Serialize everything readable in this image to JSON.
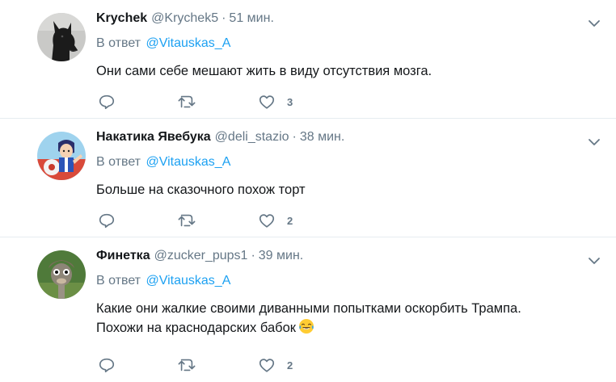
{
  "tweets": [
    {
      "fullname": "Krychek",
      "username": "@Krychek5",
      "separator": "·",
      "time": "51 мин.",
      "reply_prefix": "В ответ",
      "reply_mention": "@Vitauskas_A",
      "text_lines": [
        "Они сами себе мешают жить в виду отсутствия мозга."
      ],
      "likes": "3",
      "avatar": "black-dog-avatar"
    },
    {
      "fullname": "Накатика Явебука",
      "username": "@deli_stazio",
      "separator": "·",
      "time": "38 мин.",
      "reply_prefix": "В ответ",
      "reply_mention": "@Vitauskas_A",
      "text_lines": [
        "Больше на сказочного похож торт"
      ],
      "likes": "2",
      "avatar": "anime-character-avatar"
    },
    {
      "fullname": "Финетка",
      "username": "@zucker_pups1",
      "separator": "·",
      "time": "39 мин.",
      "reply_prefix": "В ответ",
      "reply_mention": "@Vitauskas_A",
      "text_lines": [
        "Какие они жалкие своими диванными попытками оскорбить Трампа.",
        "Похожи на краснодарских бабок"
      ],
      "text_emoji": "tears-of-joy-emoji",
      "likes": "2",
      "avatar": "ostrich-avatar"
    }
  ],
  "colors": {
    "link": "#1da1f2",
    "secondary_text": "#657786",
    "primary_text": "#14171a",
    "divider": "#e6ecf0"
  }
}
